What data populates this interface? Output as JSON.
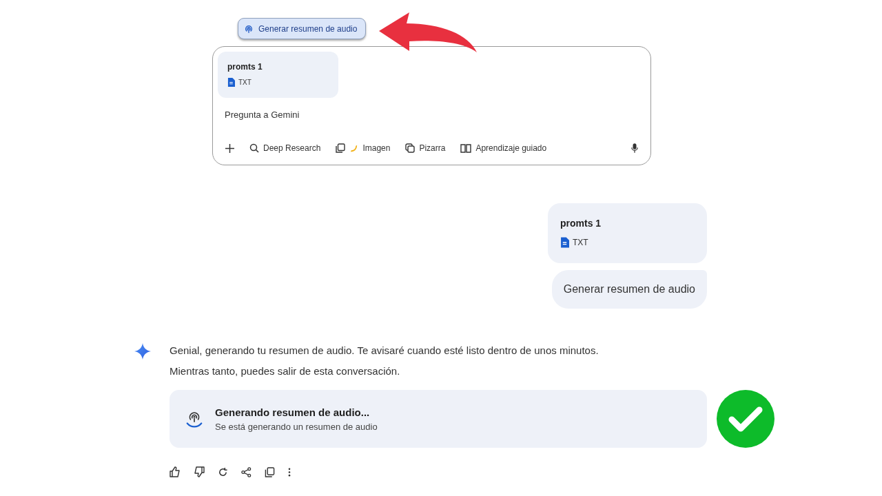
{
  "prompt_chip": {
    "label": "Generar resumen de audio"
  },
  "composer": {
    "attachment": {
      "name": "promts 1",
      "type": "TXT"
    },
    "placeholder": "Pregunta a Gemini",
    "tools": [
      {
        "label": "Deep Research"
      },
      {
        "label": "Imagen"
      },
      {
        "label": "Pizarra"
      },
      {
        "label": "Aprendizaje guiado"
      }
    ]
  },
  "user_messages": {
    "attachment": {
      "name": "promts 1",
      "type": "TXT"
    },
    "text": "Generar resumen de audio"
  },
  "response": {
    "lines": [
      "Genial, generando tu resumen de audio. Te avisaré cuando esté listo dentro de unos minutos.",
      "Mientras tanto, puedes salir de esta conversación."
    ],
    "card": {
      "title": "Generando resumen de audio...",
      "subtitle": "Se está generando un resumen de audio"
    }
  }
}
